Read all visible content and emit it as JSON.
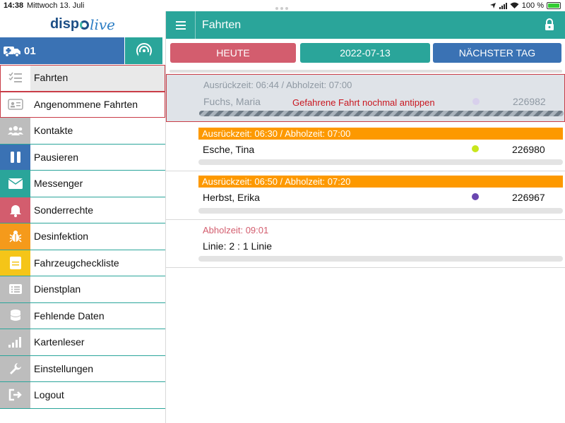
{
  "statusbar": {
    "time": "14:38",
    "date": "Mittwoch 13. Juli",
    "battery": "100 %"
  },
  "app": {
    "brand_prefix": "disp",
    "brand_suffix": "live"
  },
  "vehicle": {
    "number": "01"
  },
  "header": {
    "title": "Fahrten"
  },
  "date_nav": {
    "today": "HEUTE",
    "date": "2022-07-13",
    "next": "NÄCHSTER TAG"
  },
  "menu": [
    {
      "label": "Fahrten",
      "icon": "checklist-icon",
      "color": "#ffffff"
    },
    {
      "label": "Angenommene Fahrten",
      "icon": "id-card-icon",
      "color": "#ffffff"
    },
    {
      "label": "Kontakte",
      "icon": "people-icon",
      "color": "#bdbdbd"
    },
    {
      "label": "Pausieren",
      "icon": "pause-icon",
      "color": "#3a72b4"
    },
    {
      "label": "Messenger",
      "icon": "envelope-icon",
      "color": "#2aa59a"
    },
    {
      "label": "Sonderrechte",
      "icon": "bell-icon",
      "color": "#d35d6e"
    },
    {
      "label": "Desinfektion",
      "icon": "bug-icon",
      "color": "#f59a1b"
    },
    {
      "label": "Fahrzeugcheckliste",
      "icon": "clipboard-icon",
      "color": "#f5c518"
    },
    {
      "label": "Dienstplan",
      "icon": "list-icon",
      "color": "#bdbdbd"
    },
    {
      "label": "Fehlende Daten",
      "icon": "database-icon",
      "color": "#bdbdbd"
    },
    {
      "label": "Kartenleser",
      "icon": "signal-icon",
      "color": "#bdbdbd"
    },
    {
      "label": "Einstellungen",
      "icon": "wrench-icon",
      "color": "#bdbdbd"
    },
    {
      "label": "Logout",
      "icon": "logout-icon",
      "color": "#bdbdbd"
    }
  ],
  "trips": [
    {
      "time": "Ausrückzeit: 06:44 / Abholzeit: 07:00",
      "name": "Fuchs, Maria",
      "number": "226982",
      "hint": "Gefahrene Fahrt nochmal antippen",
      "dot_color": "#d8d0ec",
      "state": "done"
    },
    {
      "time": "Ausrückzeit: 06:30 / Abholzeit: 07:00",
      "name": "Esche, Tina",
      "number": "226980",
      "dot_color": "#c8e61c",
      "state": "active"
    },
    {
      "time": "Ausrückzeit: 06:50 / Abholzeit: 07:20",
      "name": "Herbst, Erika",
      "number": "226967",
      "dot_color": "#6a47b0",
      "state": "active"
    },
    {
      "time": "Abholzeit: 09:01",
      "name": "Linie: 2 : 1 Linie",
      "state": "line"
    }
  ],
  "colors": {
    "teal": "#2aa59a",
    "blue": "#3a72b4",
    "red": "#d35d6e",
    "orange": "#fd9900",
    "highlight_border": "#c93c47"
  }
}
